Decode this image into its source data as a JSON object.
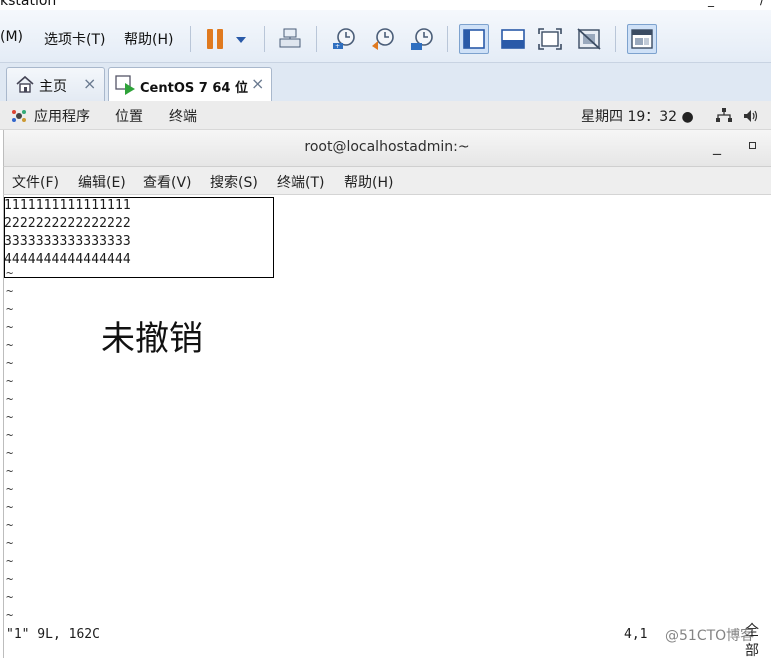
{
  "window": {
    "title": "kstation",
    "title_controls": [
      "_",
      "/"
    ]
  },
  "vm_menu": {
    "items": [
      "(M)",
      "选项卡(T)",
      "帮助(H)"
    ]
  },
  "vm_toolbar": {
    "icons": [
      "pause-icon",
      "dropdown-arrow-icon",
      "send-ctrl-alt-del-icon",
      "snapshot-take-icon",
      "snapshot-revert-icon",
      "snapshot-manager-icon",
      "console-view-icon",
      "fullscreen-bar-icon",
      "fit-window-icon",
      "unity-icon",
      "thumbnail-view-icon"
    ]
  },
  "vm_tabs": [
    {
      "label": "主页",
      "icon": "home-icon",
      "close": "×"
    },
    {
      "label": "CentOS 7 64 位",
      "icon": "vm-running-icon",
      "close": "×",
      "active": true
    }
  ],
  "gnome_panel": {
    "apps": "应用程序",
    "places": "位置",
    "terminal": "终端",
    "clock": "星期四 19：32 ●"
  },
  "terminal": {
    "title": "root@localhostadmin:~",
    "minimize": "_",
    "menu": [
      "文件(F)",
      "编辑(E)",
      "查看(V)",
      "搜索(S)",
      "终端(T)",
      "帮助(H)"
    ],
    "lines": [
      "1111111111111111",
      "2222222222222222",
      "3333333333333333",
      "4444444444444444"
    ],
    "tilde": "~",
    "status_left": "\"1\" 9L, 162C",
    "status_right": "4,1",
    "status_far": "全部"
  },
  "annotation": "未撤销",
  "watermark": "@51CTO博客",
  "colors": {
    "accent": "#e07a1f",
    "toolbar_blue": "#2a5aa8",
    "panel": "#ececec"
  }
}
